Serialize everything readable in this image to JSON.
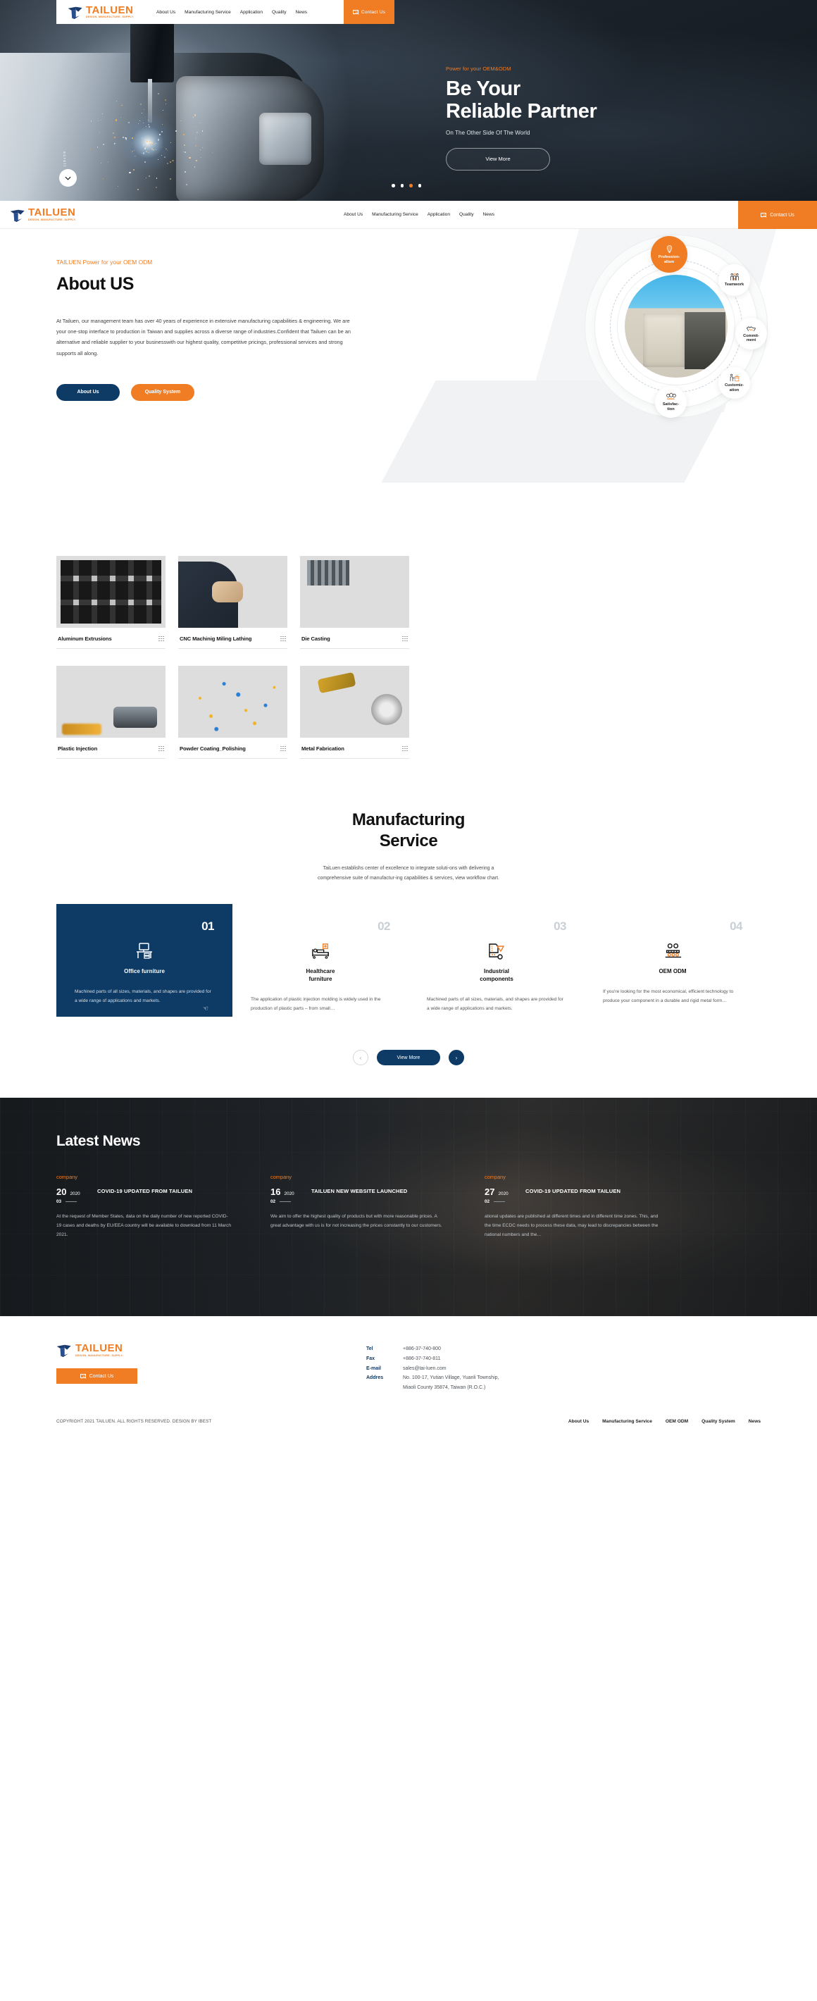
{
  "brand": {
    "name": "TAILUEN",
    "tagline": "DESIGN. MANUFACTURE. SUPPLY.",
    "accent_orange": "#f07c23",
    "accent_navy": "#0d3b66"
  },
  "nav": {
    "items": [
      {
        "label": "About Us"
      },
      {
        "label": "Manufacturing Service"
      },
      {
        "label": "Application"
      },
      {
        "label": "Quality"
      },
      {
        "label": "News"
      }
    ],
    "cta_label": "Contact Us"
  },
  "hero": {
    "eyebrow": "Power for your OEM&ODM",
    "title_line1": "Be Your",
    "title_line2": "Reliable Partner",
    "subtitle": "On The Other Side Of The World",
    "button_label": "View More",
    "scroll_label": "scroll",
    "slide_count": 4,
    "active_slide": 3
  },
  "about": {
    "eyebrow": "TAILUEN Power for your OEM ODM",
    "heading": "About US",
    "paragraph": "At Tailuen, our management team has over 40 years of experience in extensive manufacturing capabilities & engineering.\nWe are your one-stop interface to production in Taiwan and supplies across a diverse range of industries.Confident that Tailuen can be an alternative and reliable supplier to your businesswith our highest quality, competitive pricings, professional services and strong supports all along.",
    "btn_primary": "About Us",
    "btn_secondary": "Quality System",
    "bubbles": [
      {
        "label": "Profession-\nalism",
        "icon": "lightbulb-globe-icon",
        "primary": true
      },
      {
        "label": "Teamwork",
        "icon": "team-people-icon",
        "primary": false
      },
      {
        "label": "Commit-\nment",
        "icon": "handshake-icon",
        "primary": false
      },
      {
        "label": "Customiz-\nation",
        "icon": "customization-icon",
        "primary": false
      },
      {
        "label": "Satisfac-\ntion",
        "icon": "satisfaction-faces-icon",
        "primary": false
      }
    ]
  },
  "products": {
    "row1": [
      {
        "name": "Aluminum Extrusions",
        "img": "img-alum"
      },
      {
        "name": "CNC Machinig Miling Lathing",
        "img": "img-cnc"
      },
      {
        "name": "Die Casting",
        "img": "img-die"
      }
    ],
    "row2": [
      {
        "name": "Plastic Injection",
        "img": "img-plast"
      },
      {
        "name": "Powder Coating_Polishing",
        "img": "img-powder"
      },
      {
        "name": "Metal Fabrication",
        "img": "img-metal"
      }
    ]
  },
  "service": {
    "title_line1": "Manufacturing",
    "title_line2": "Service",
    "lead_line1": "TaiLuen establishs center of excellence to integrate soluti-ons with delivering a",
    "lead_line2": "comprehensive suite of manufactur-ing capabilities & services, view workflow chart.",
    "cards": [
      {
        "num": "01",
        "title": "Office furniture",
        "icon": "desk-computer-icon",
        "desc": "Machined parts of all sizes, materials, and shapes are provided for a wide range of applications and markets.",
        "active": true
      },
      {
        "num": "02",
        "title": "Healthcare\nfurniture",
        "icon": "hospital-bed-icon",
        "desc": "The application of plastic injection molding is widely used in the production of plastic parts – from small…",
        "active": false
      },
      {
        "num": "03",
        "title": "Industrial\ncomponents",
        "icon": "industrial-part-icon",
        "desc": "Machined parts of all sizes, materials, and shapes are provided for a wide range of applications and markets.",
        "active": false
      },
      {
        "num": "04",
        "title": "OEM ODM",
        "icon": "assembly-line-icon",
        "desc": "If you're looking for the most economical, efficient technology to produce your component in a durable and rigid metal form…",
        "active": false
      }
    ],
    "prev_label": "‹",
    "next_label": "›",
    "view_more_label": "View More"
  },
  "news": {
    "heading": "Latest News",
    "items": [
      {
        "tag": "company",
        "day": "20",
        "month": "03",
        "year": "2020",
        "title": "COVID-19 UPDATED FROM TAILUEN",
        "body": "At the request of Member States, data on the daily number of new reported COVID-19 cases and deaths by EU/EEA country will be available to download from 11 March 2021."
      },
      {
        "tag": "company",
        "day": "16",
        "month": "02",
        "year": "2020",
        "title": "TAILUEN NEW WEBSITE LAUNCHED",
        "body": "We aim to offer the highest quality of products but with more reasonable prices. A great advantage with us is for not increasing the prices constantly to our customers."
      },
      {
        "tag": "company",
        "day": "27",
        "month": "02",
        "year": "2020",
        "title": "COVID-19 UPDATED FROM TAILUEN",
        "body": "ational updates are published at different times and in different time zones. This, and the time ECDC needs to process these data, may lead to discrepancies between the national numbers and the…"
      }
    ]
  },
  "footer": {
    "contact_btn": "Contact Us",
    "contact": [
      {
        "key": "Tel",
        "value": "+886-37-740-800"
      },
      {
        "key": "Fax",
        "value": "+886-37-740-811"
      },
      {
        "key": "E-mail",
        "value": "sales@tai-luen.com"
      },
      {
        "key": "Addres",
        "value": "No. 100-17, Yutian Village, Yuanli Township,"
      },
      {
        "key": "",
        "value": "Miaoli County 35874, Taiwan (R.O.C.)"
      }
    ],
    "copyright": "COPYRIGHT 2021 TAILUEN. ALL RIGHTS RESERVED. DESIGN BY IBEST",
    "links": [
      {
        "label": "About Us"
      },
      {
        "label": "Manufacturing Service"
      },
      {
        "label": "OEM ODM"
      },
      {
        "label": "Quality System"
      },
      {
        "label": "News"
      }
    ]
  }
}
